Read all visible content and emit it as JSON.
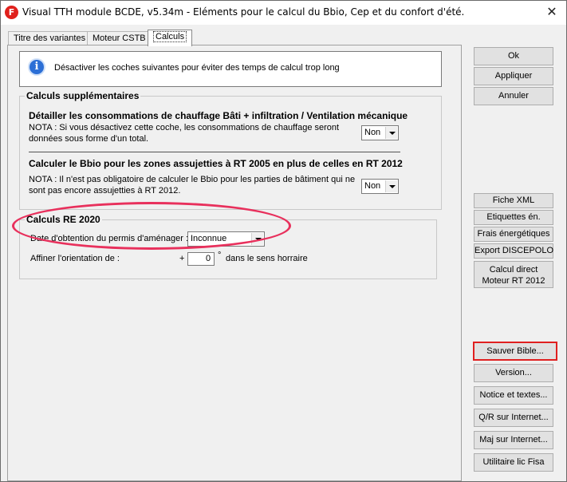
{
  "window": {
    "title": "Visual TTH module BCDE, v5.34m - Eléments pour le calcul du Bbio, Cep et du confort d'été.",
    "app_icon_letter": "F",
    "close_glyph": "✕"
  },
  "tabs": [
    {
      "label": "Titre des variantes",
      "active": false
    },
    {
      "label": "Moteur CSTB",
      "active": false
    },
    {
      "label": "Calculs",
      "active": true
    }
  ],
  "info": {
    "icon": "info-icon",
    "icon_glyph": "i",
    "text": "Désactiver les coches suivantes pour éviter des temps de calcul trop long"
  },
  "calculs_supp": {
    "legend": "Calculs supplémentaires",
    "item1": {
      "heading": "Détailler les consommations de chauffage Bâti + infiltration / Ventilation mécanique",
      "nota_line1": "NOTA : Si vous désactivez cette coche, les consommations de chauffage seront",
      "nota_line2": "données sous forme d'un total.",
      "value": "Non"
    },
    "item2": {
      "heading": "Calculer le Bbio pour les zones assujetties à RT 2005 en plus de celles en RT 2012",
      "nota_line1": "NOTA : Il n'est pas obligatoire de calculer le Bbio pour les parties de bâtiment qui ne",
      "nota_line2": "sont pas encore assujetties à RT 2012.",
      "value": "Non"
    }
  },
  "re2020": {
    "legend": "Calculs RE 2020",
    "permis_label": "Date d'obtention du permis d'aménager :",
    "permis_value": "Inconnue",
    "orientation_label": "Affiner l'orientation de :",
    "orientation_sign": "+",
    "orientation_value": "0",
    "degree": "°",
    "orientation_suffix": "dans le sens horraire"
  },
  "buttons": {
    "ok": "Ok",
    "appliquer": "Appliquer",
    "annuler": "Annuler",
    "fiche_xml": "Fiche XML",
    "etiquettes": "Etiquettes én.",
    "frais": "Frais énergétiques",
    "export": "Export DISCEPOLO",
    "calcul_direct_1": "Calcul direct",
    "calcul_direct_2": "Moteur RT 2012",
    "sauver_bible": "Sauver Bible...",
    "version": "Version...",
    "notice": "Notice et textes...",
    "qr": "Q/R sur Internet...",
    "maj": "Maj sur Internet...",
    "utilitaire": "Utilitaire lic Fisa"
  },
  "colors": {
    "highlight_ellipse": "#e8305c",
    "highlight_button_border": "#e02020",
    "info_icon_blue": "#2c6fd6"
  }
}
